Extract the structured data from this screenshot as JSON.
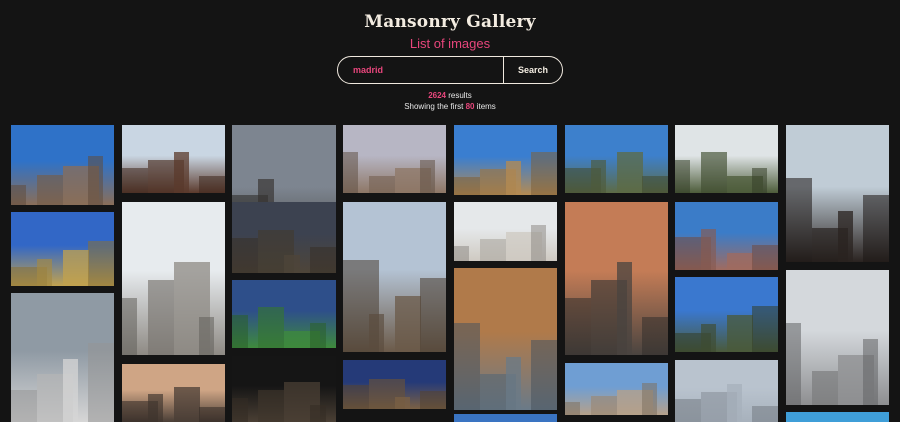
{
  "header": {
    "title": "Mansonry Gallery",
    "subtitle": "List of images"
  },
  "search": {
    "value": "madrid",
    "placeholder": "",
    "button_label": "Search"
  },
  "results": {
    "count": "2624",
    "count_suffix": " results",
    "showing_prefix": "Showing the first ",
    "showing_count": "80",
    "showing_suffix": " items"
  },
  "colors": {
    "background": "#141414",
    "accent": "#e8467c",
    "title": "#f3ece1"
  },
  "gallery": {
    "columns": 8,
    "tiles": [
      {
        "subject": "city-panorama-blue-sky",
        "sky": "#2f72c8",
        "ground": "#8a6e58"
      },
      {
        "subject": "plaza-mayor-facade",
        "sky": "#c9d6e3",
        "ground": "#5b3a2c"
      },
      {
        "subject": "gran-via-cloudy",
        "sky": "#7d8590",
        "ground": "#3e3a37"
      },
      {
        "subject": "rooftops-sunset",
        "sky": "#b7b6c4",
        "ground": "#8e7766"
      },
      {
        "subject": "ornate-building-street",
        "sky": "#3a7ed0",
        "ground": "#b58b52"
      },
      {
        "subject": "royal-palace-trees",
        "sky": "#3d80cc",
        "ground": "#5d6b45"
      },
      {
        "subject": "palace-garden-trees",
        "sky": "#dfe4e6",
        "ground": "#4d5c3a"
      },
      {
        "subject": "arch-view-cathedral",
        "sky": "#c0ccd6",
        "ground": "#2a2320"
      },
      {
        "subject": "puerta-alcala-blue",
        "sky": "#3267c6",
        "ground": "#c2a24e"
      },
      {
        "subject": "metropolis-dome",
        "sky": "#e7ebee",
        "ground": "#8e8a84"
      },
      {
        "subject": "metropolis-night",
        "sky": "#3c4250",
        "ground": "#4e4539"
      },
      {
        "subject": "skyline-from-above",
        "sky": "#b4c3d4",
        "ground": "#6b5a49"
      },
      {
        "subject": "white-palace-facade",
        "sky": "#e5e8ea",
        "ground": "#cfcac2"
      },
      {
        "subject": "sunset-cityscape",
        "sky": "#c47c56",
        "ground": "#4a4440"
      },
      {
        "subject": "pink-buildings-street",
        "sky": "#3b7cc8",
        "ground": "#a06b5f"
      },
      {
        "subject": "red-wall-post",
        "sky": "#d4d8dc",
        "ground": "#8e8f91"
      },
      {
        "subject": "crosswalk-man",
        "sky": "#8f9aa4",
        "ground": "#d6d6d6"
      },
      {
        "subject": "dusk-tower-building",
        "sky": "#cfa585",
        "ground": "#4a3e36"
      },
      {
        "subject": "stadium-aerial",
        "sky": "#2e4f8a",
        "ground": "#3e8a3c"
      },
      {
        "subject": "airport-terminal-roof",
        "sky": "#b07a4a",
        "ground": "#6a7a88"
      },
      {
        "subject": "statue-blue-sky",
        "sky": "#3a78cf",
        "ground": "#4a5a3a"
      },
      {
        "subject": "church-night",
        "sky": "#151515",
        "ground": "#4a3f34"
      },
      {
        "subject": "castle-hill-dusk",
        "sky": "#253a78",
        "ground": "#7a6044"
      },
      {
        "subject": "sky-strip",
        "sky": "#3a74c2",
        "ground": "#3a74c2"
      },
      {
        "subject": "town-panorama",
        "sky": "#6f9ed3",
        "ground": "#b6a18a"
      },
      {
        "subject": "cloudy-sky",
        "sky": "#b9c3ce",
        "ground": "#a7b1bc"
      },
      {
        "subject": "blue-sky-strip",
        "sky": "#3f9ed8",
        "ground": "#3f9ed8"
      }
    ]
  }
}
